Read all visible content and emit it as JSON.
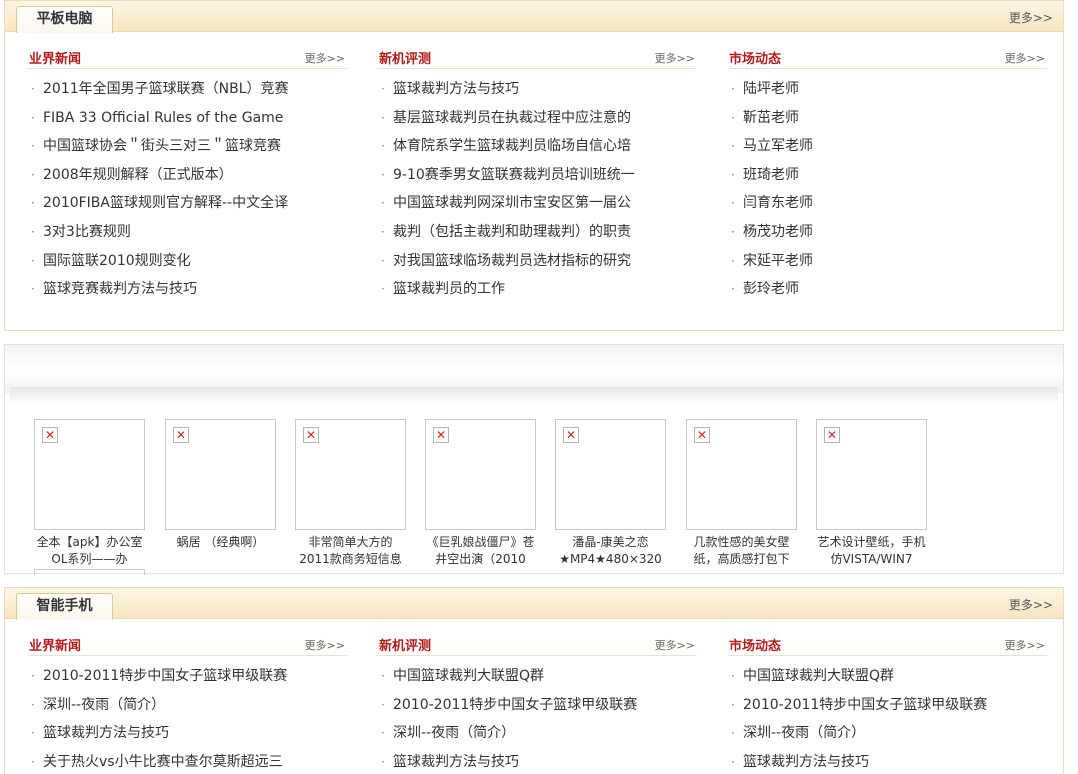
{
  "panel1": {
    "tab": "平板电脑",
    "more": "更多>>",
    "columns": [
      {
        "title": "业界新闻",
        "more": "更多>>",
        "items": [
          "2011年全国男子篮球联赛（NBL）竞赛",
          "FIBA 33 Official Rules of the Game",
          "中国篮球协会＂街头三对三＂篮球竞赛",
          "2008年规则解释（正式版本）",
          "2010FIBA篮球规则官方解释--中文全译",
          "3对3比赛规则",
          "国际篮联2010规则变化",
          "篮球竞赛裁判方法与技巧"
        ]
      },
      {
        "title": "新机评测",
        "more": "更多>>",
        "items": [
          "篮球裁判方法与技巧",
          "基层篮球裁判员在执裁过程中应注意的",
          "体育院系学生篮球裁判员临场自信心培",
          "9-10赛季男女篮联赛裁判员培训班统一",
          "中国篮球裁判网深圳市宝安区第一届公",
          "裁判（包括主裁判和助理裁判）的职责",
          "对我国篮球临场裁判员选材指标的研究",
          "篮球裁判员的工作"
        ]
      },
      {
        "title": "市场动态",
        "more": "更多>>",
        "items": [
          "陆坪老师",
          "靳茁老师",
          "马立军老师",
          "班琦老师",
          "闫育东老师",
          "杨茂功老师",
          "宋延平老师",
          "彭玲老师"
        ]
      }
    ]
  },
  "gallery": {
    "items": [
      "全本【apk】办公室OL系列——办",
      "蜗居 （经典啊）",
      "非常简单大方的2011款商务短信息",
      "《巨乳娘战僵尸》苍井空出演（2010",
      "潘晶-康美之恋★MP4★480×320",
      "几款性感的美女壁纸，高质感打包下",
      "艺术设计壁纸，手机仿VISTA/WIN7"
    ]
  },
  "panel2": {
    "tab": "智能手机",
    "more": "更多>>",
    "columns": [
      {
        "title": "业界新闻",
        "more": "更多>>",
        "items": [
          "2010-2011特步中国女子篮球甲级联赛",
          "深圳--夜雨（简介）",
          "篮球裁判方法与技巧",
          "关于热火vs小牛比赛中查尔莫斯超远三"
        ]
      },
      {
        "title": "新机评测",
        "more": "更多>>",
        "items": [
          "中国篮球裁判大联盟Q群",
          "2010-2011特步中国女子篮球甲级联赛",
          "深圳--夜雨（简介）",
          "篮球裁判方法与技巧"
        ]
      },
      {
        "title": "市场动态",
        "more": "更多>>",
        "items": [
          "中国篮球裁判大联盟Q群",
          "2010-2011特步中国女子篮球甲级联赛",
          "深圳--夜雨（简介）",
          "篮球裁判方法与技巧"
        ]
      }
    ]
  }
}
